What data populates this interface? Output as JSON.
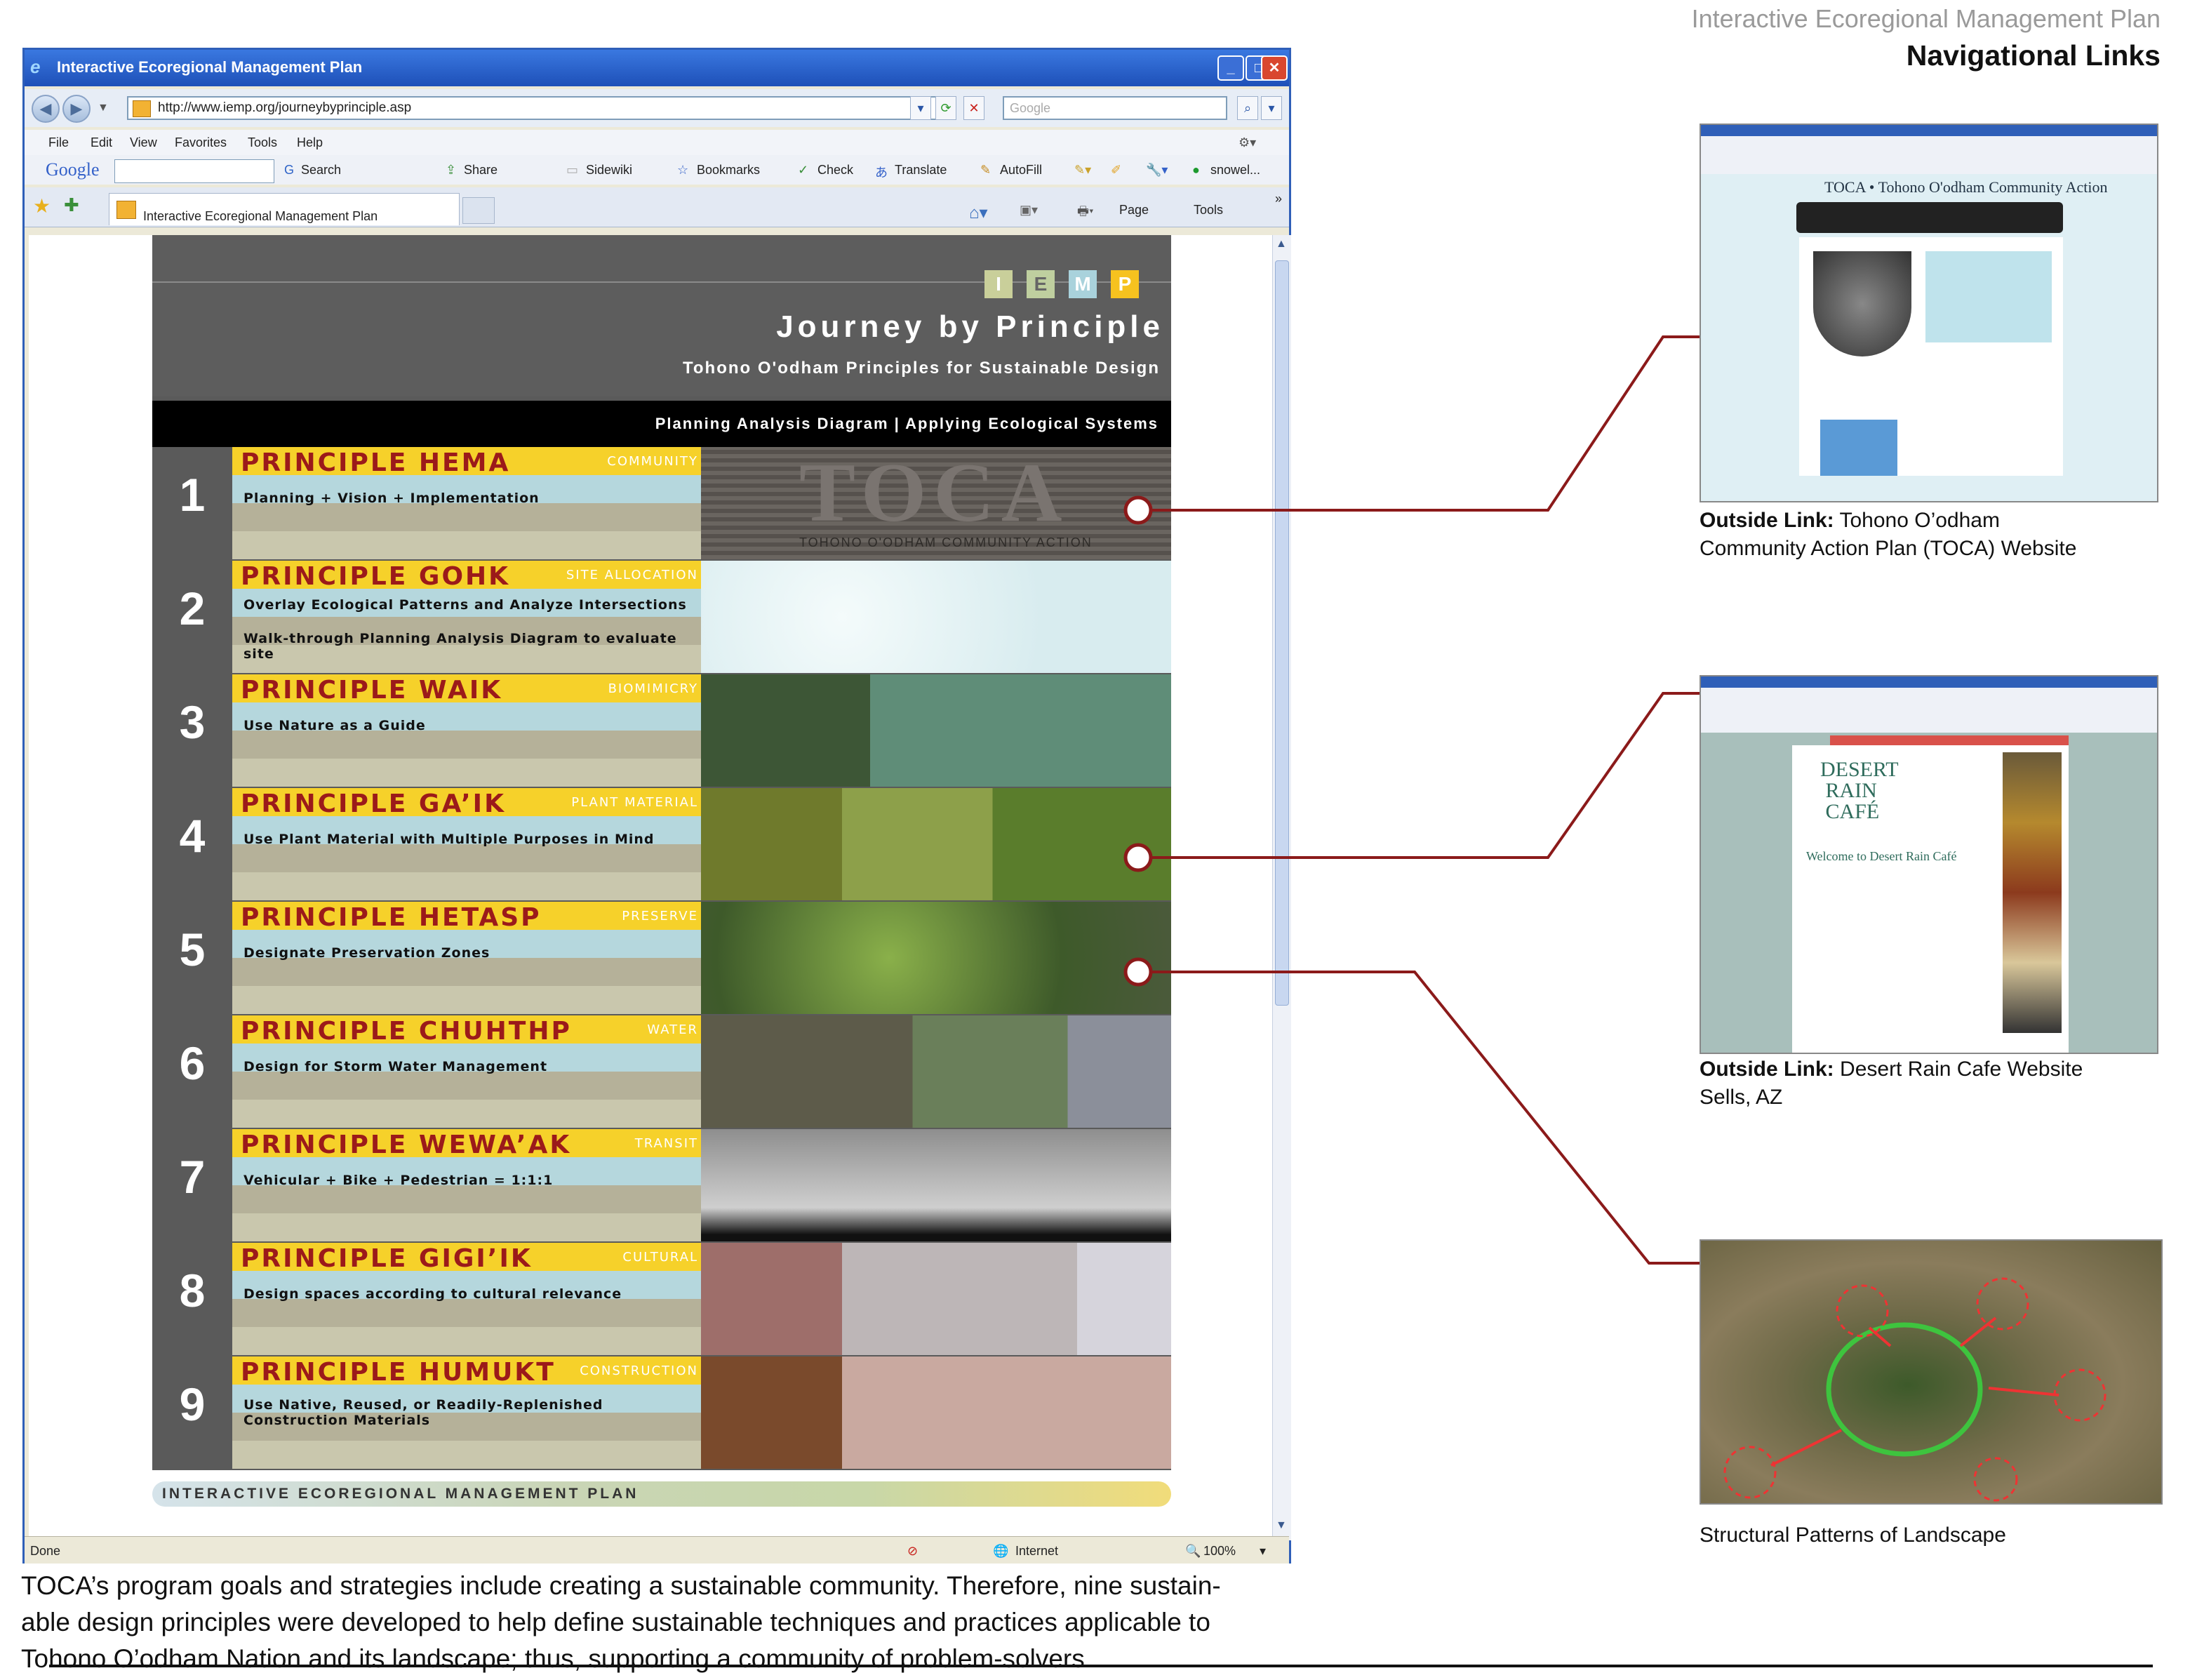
{
  "header": {
    "subtitle": "Interactive Ecoregional Management Plan",
    "title": "Navigational Links"
  },
  "browser": {
    "window_title": "Interactive Ecoregional Management Plan",
    "url": "http://www.iemp.org/journeybyprinciple.asp",
    "search_placeholder": "Google",
    "menu": [
      "File",
      "Edit",
      "View",
      "Favorites",
      "Tools",
      "Help"
    ],
    "google_toolbar": {
      "logo": "Google",
      "items": [
        "Search",
        "Share",
        "Sidewiki",
        "Bookmarks",
        "Check",
        "Translate",
        "AutoFill",
        "snowel..."
      ]
    },
    "tab_label": "Interactive Ecoregional Management Plan",
    "command_bar": [
      "Page",
      "Tools"
    ],
    "status": {
      "left": "Done",
      "zone": "Internet",
      "zoom": "100%"
    }
  },
  "webpage": {
    "logo_letters": [
      "I",
      "E",
      "M",
      "P"
    ],
    "heading": "Journey by Principle",
    "subheading": "Tohono O'odham Principles for Sustainable Design",
    "bar_text": "Planning Analysis Diagram | Applying Ecological Systems",
    "principles": [
      {
        "num": "1",
        "name": "PRINCIPLE HEMA",
        "category": "community",
        "desc": "Planning + Vision + Implementation"
      },
      {
        "num": "2",
        "name": "PRINCIPLE GOHK",
        "category": "site allocation",
        "desc": "Overlay Ecological Patterns and Analyze Intersections",
        "desc2": "Walk-through Planning Analysis Diagram to evaluate site"
      },
      {
        "num": "3",
        "name": "PRINCIPLE WAIK",
        "category": "biomimicry",
        "desc": "Use Nature as a Guide"
      },
      {
        "num": "4",
        "name": "PRINCIPLE GA’IK",
        "category": "plant material",
        "desc": "Use Plant Material with Multiple Purposes in Mind"
      },
      {
        "num": "5",
        "name": "PRINCIPLE HETASP",
        "category": "preserve",
        "desc": "Designate Preservation  Zones"
      },
      {
        "num": "6",
        "name": "PRINCIPLE CHUHTHP",
        "category": "water",
        "desc": "Design for Storm Water Management"
      },
      {
        "num": "7",
        "name": "PRINCIPLE WEWA’AK",
        "category": "transit",
        "desc": "Vehicular + Bike + Pedestrian = 1:1:1"
      },
      {
        "num": "8",
        "name": "PRINCIPLE GIGI’IK",
        "category": "cultural",
        "desc": "Design spaces according to cultural relevance"
      },
      {
        "num": "9",
        "name": "PRINCIPLE HUMUKT",
        "category": "construction",
        "desc": "Use Native, Reused, or Readily-Replenished",
        "desc2": "Construction Materials"
      }
    ],
    "toca_sign": "TOCA",
    "toca_sign_sub": "TOHONO O'ODHAM COMMUNITY ACTION",
    "footer_bar": "INTERACTIVE ECOREGIONAL MANAGEMENT PLAN"
  },
  "links": [
    {
      "label": "Outside Link:",
      "text_line1": "Tohono O’odham",
      "text_line2": "Community Action Plan (TOCA) Website",
      "thumb_title": "TOCA • Tohono O'odham Community Action"
    },
    {
      "label": "Outside Link:",
      "text_line1": "Desert Rain Cafe Website",
      "text_line2": "Sells, AZ",
      "thumb_title": "Welcome to Desert Rain Café"
    },
    {
      "label": "",
      "text_line1": "Structural Patterns of Landscape",
      "text_line2": ""
    }
  ],
  "paragraph": {
    "line1": "TOCA’s program goals and strategies include creating a sustainable community. Therefore, nine sustain-",
    "line2": "able design principles were developed to help define sustainable techniques and practices applicable to",
    "line3": "Tohono O’odham Nation and its landscape; thus, supporting a community of problem-solvers."
  },
  "colors": {
    "connector": "#8b1a1a",
    "principle_title_bg": "#f6d12a",
    "principle_title_text": "#9b1a1a",
    "browser_title": "#2f5fb8"
  }
}
